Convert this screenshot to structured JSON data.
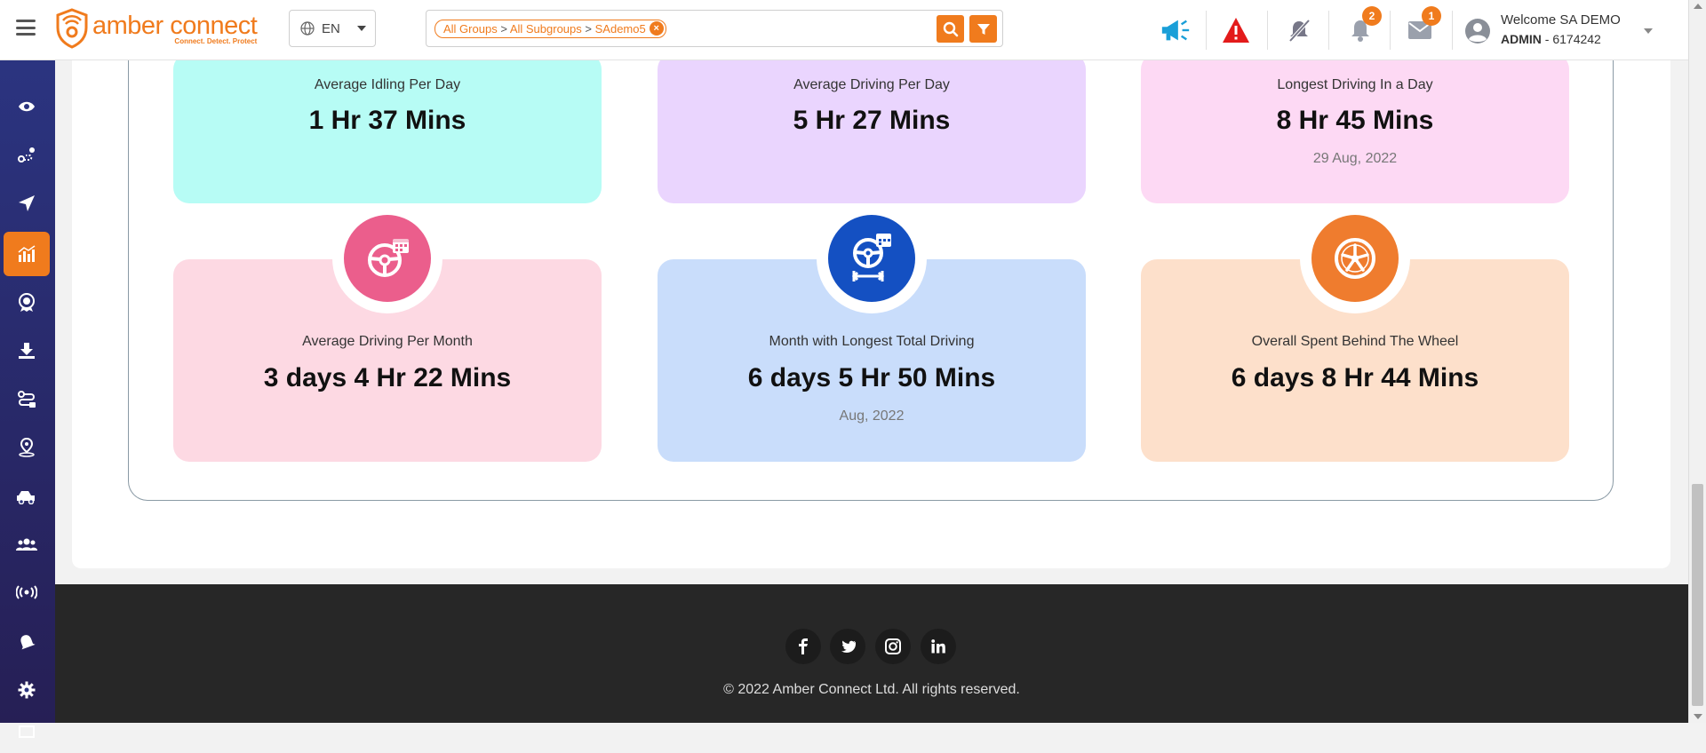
{
  "header": {
    "logo_name": "amber connect",
    "logo_tagline": "Connect. Detect. Protect",
    "language": "EN",
    "filter_chip": {
      "groups": "All Groups",
      "subgroups": "All Subgroups",
      "device": "SAdemo5",
      "separator": ">"
    },
    "notifications_count": "2",
    "messages_count": "1",
    "user": {
      "welcome": "Welcome SA DEMO",
      "role": "ADMIN",
      "account_id": "- 6174242"
    }
  },
  "sidebar": {
    "items": [
      {
        "icon": "eye-icon"
      },
      {
        "icon": "route-icon"
      },
      {
        "icon": "navigation-arrow-icon"
      },
      {
        "icon": "analytics-chart-icon",
        "active": true
      },
      {
        "icon": "award-badge-icon"
      },
      {
        "icon": "download-icon"
      },
      {
        "icon": "trip-route-icon"
      },
      {
        "icon": "map-pin-icon"
      },
      {
        "icon": "vehicles-icon"
      },
      {
        "icon": "users-group-icon"
      },
      {
        "icon": "broadcast-icon"
      },
      {
        "icon": "alerts-icon"
      },
      {
        "icon": "settings-gear-icon"
      },
      {
        "icon": "monitor-icon"
      }
    ]
  },
  "stats": {
    "cards": [
      {
        "label": "Average Idling Per Day",
        "value": "1 Hr 37 Mins",
        "sub": "",
        "bg": "#b7fcf5"
      },
      {
        "label": "Average Driving Per Day",
        "value": "5 Hr 27 Mins",
        "sub": "",
        "bg": "#ead5fe"
      },
      {
        "label": "Longest Driving In a Day",
        "value": "8 Hr 45 Mins",
        "sub": "29 Aug, 2022",
        "bg": "#fdd9f4"
      },
      {
        "label": "Average Driving Per Month",
        "value": "3 days 4 Hr 22 Mins",
        "sub": "",
        "bg": "#fdd9e3",
        "icon": "steering-calendar-icon",
        "icon_bg": "#eb5e8c"
      },
      {
        "label": "Month with Longest Total Driving",
        "value": "6 days 5 Hr 50 Mins",
        "sub": "Aug, 2022",
        "bg": "#c9ddfb",
        "icon": "steering-distance-icon",
        "icon_bg": "#1450c2"
      },
      {
        "label": "Overall Spent Behind The Wheel",
        "value": "6 days 8 Hr 44 Mins",
        "sub": "",
        "bg": "#fde0cb",
        "icon": "wheel-icon",
        "icon_bg": "#ef7c2e"
      }
    ]
  },
  "footer": {
    "social": [
      "facebook-icon",
      "twitter-icon",
      "instagram-icon",
      "linkedin-icon"
    ],
    "copyright": "© 2022 Amber Connect Ltd. All rights reserved."
  },
  "colors": {
    "accent": "#f07b1d",
    "sidebar_top": "#2b3480",
    "sidebar_bottom": "#261f55",
    "footer": "#272727"
  }
}
